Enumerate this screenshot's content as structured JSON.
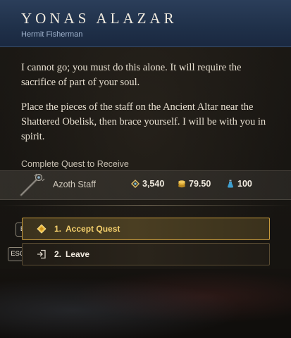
{
  "npc": {
    "name": "YONAS ALAZAR",
    "title": "Hermit Fisherman"
  },
  "dialogue": {
    "paragraph_1": "I cannot go; you must do this alone. It will require the sacrifice of part of your soul.",
    "paragraph_2": "Place the pieces of the staff on the Ancient Altar near the Shattered Obelisk, then brace yourself. I will be with you in spirit."
  },
  "reward": {
    "caption": "Complete Quest to Receive",
    "item_name": "Azoth Staff",
    "item_icon": "staff-icon",
    "azoth": "3,540",
    "azoth_icon": "azoth-icon",
    "coin": "79.50",
    "coin_icon": "coin-stack-icon",
    "vial": "100",
    "vial_icon": "vial-icon"
  },
  "options": [
    {
      "key": "E",
      "number": "1.",
      "label": "Accept Quest",
      "icon": "quest-diamond-icon"
    },
    {
      "key": "ESC",
      "number": "2.",
      "label": "Leave",
      "icon": "exit-door-icon"
    }
  ],
  "colors": {
    "header_blue": "#1f3049",
    "accent_gold": "#f4cf6c",
    "option_border_gold": "#c89b3c"
  }
}
